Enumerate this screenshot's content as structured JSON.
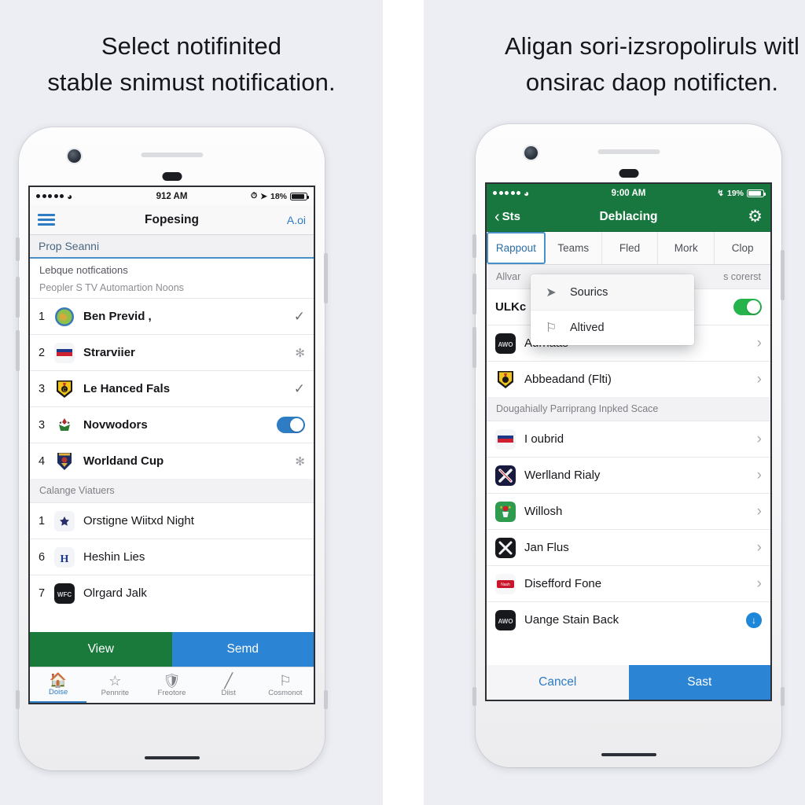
{
  "left_panel": {
    "caption_line1": "Select notifinited",
    "caption_line2": "stable snimust notification.",
    "status": {
      "time": "912 AM",
      "battery": "18%"
    },
    "nav": {
      "title": "Fopesing",
      "action": "A.oi",
      "menu_icon": "hamburger-icon"
    },
    "search": {
      "text": "Prop Seanni"
    },
    "section1": {
      "title": "Lebque notfications",
      "subtitle": "Peopler S TV Automartion Noons",
      "rows": [
        {
          "rank": "1",
          "name": "Ben Previd ,",
          "accessory": "check",
          "crest": "globe"
        },
        {
          "rank": "2",
          "name": "Strarviier",
          "accessory": "star",
          "crest": "flag-ru"
        },
        {
          "rank": "3",
          "name": "Le Hanced Fals",
          "accessory": "check",
          "crest": "shield-yellow"
        },
        {
          "rank": "3",
          "name": "Novwodors",
          "accessory": "toggle-on-blue",
          "crest": "crest-white"
        },
        {
          "rank": "4",
          "name": "Worldand Cup",
          "accessory": "star",
          "crest": "shield-navy"
        }
      ]
    },
    "section2": {
      "title": "Calange Viatuers",
      "rows": [
        {
          "rank": "1",
          "name": "Orstigne Wiitxd Night",
          "accessory": "none",
          "crest": "light-badge"
        },
        {
          "rank": "6",
          "name": "Heshin Lies",
          "accessory": "none",
          "crest": "light-h"
        },
        {
          "rank": "7",
          "name": "Olrgard Jalk",
          "accessory": "none",
          "crest": "dark-wfc"
        }
      ]
    },
    "actions": {
      "primary": "View",
      "secondary": "Semd"
    },
    "tabbar": [
      {
        "label": "Doise",
        "icon": "home-icon",
        "active": true
      },
      {
        "label": "Pennrite",
        "icon": "star-icon",
        "active": false
      },
      {
        "label": "Freotore",
        "icon": "shield-icon",
        "active": false
      },
      {
        "label": "Diist",
        "icon": "pencil-icon",
        "active": false
      },
      {
        "label": "Cosmonot",
        "icon": "bell-icon",
        "active": false
      }
    ]
  },
  "right_panel": {
    "caption_line1": "Aligan sori-izsropoliruls witl",
    "caption_line2": "onsirac daop notificten.",
    "status": {
      "time": "9:00 AM",
      "battery": "19%"
    },
    "nav": {
      "back": "Sts",
      "title": "Deblacing",
      "settings_icon": "gear-icon"
    },
    "tabs": [
      {
        "label": "Rappout",
        "active": true
      },
      {
        "label": "Teams",
        "active": false
      },
      {
        "label": "Fled",
        "active": false
      },
      {
        "label": "Mork",
        "active": false
      },
      {
        "label": "Clop",
        "active": false
      }
    ],
    "section_header_left": "Allvar",
    "section_header_right": "s corerst",
    "highlight_row": {
      "name": "ULKc",
      "accessory": "toggle-on-green"
    },
    "popup": {
      "items": [
        {
          "label": "Sourics",
          "icon": "send-icon"
        },
        {
          "label": "Altived",
          "icon": "bell-icon"
        }
      ]
    },
    "group1": [
      {
        "name": "Aurriaas",
        "accessory": "chevron",
        "crest": "dark-awo"
      },
      {
        "name": "Abbeadand (Flti)",
        "accessory": "chevron",
        "crest": "shield-yellow"
      }
    ],
    "group_header": "Dougahially Parriprang Inpked Scace",
    "group2": [
      {
        "name": "I oubrid",
        "accessory": "chevron",
        "crest": "flag-ru"
      },
      {
        "name": "Werlland Rialy",
        "accessory": "chevron",
        "crest": "navy-x"
      },
      {
        "name": "Willosh",
        "accessory": "chevron",
        "crest": "green-crest"
      },
      {
        "name": "Jan Flus",
        "accessory": "chevron",
        "crest": "dark-x"
      },
      {
        "name": "Disefford Fone",
        "accessory": "chevron",
        "crest": "red-badge"
      },
      {
        "name": "Uange Stain Back",
        "accessory": "download",
        "crest": "dark-awo"
      }
    ],
    "footer": {
      "cancel": "Cancel",
      "confirm": "Sast"
    }
  },
  "colors": {
    "accent_blue": "#2e7cc4",
    "accent_green": "#18773f",
    "button_green": "#1a7a3c",
    "button_blue": "#2b84d4",
    "toggle_green": "#26b34b",
    "panel_bg": "#eceef3"
  }
}
